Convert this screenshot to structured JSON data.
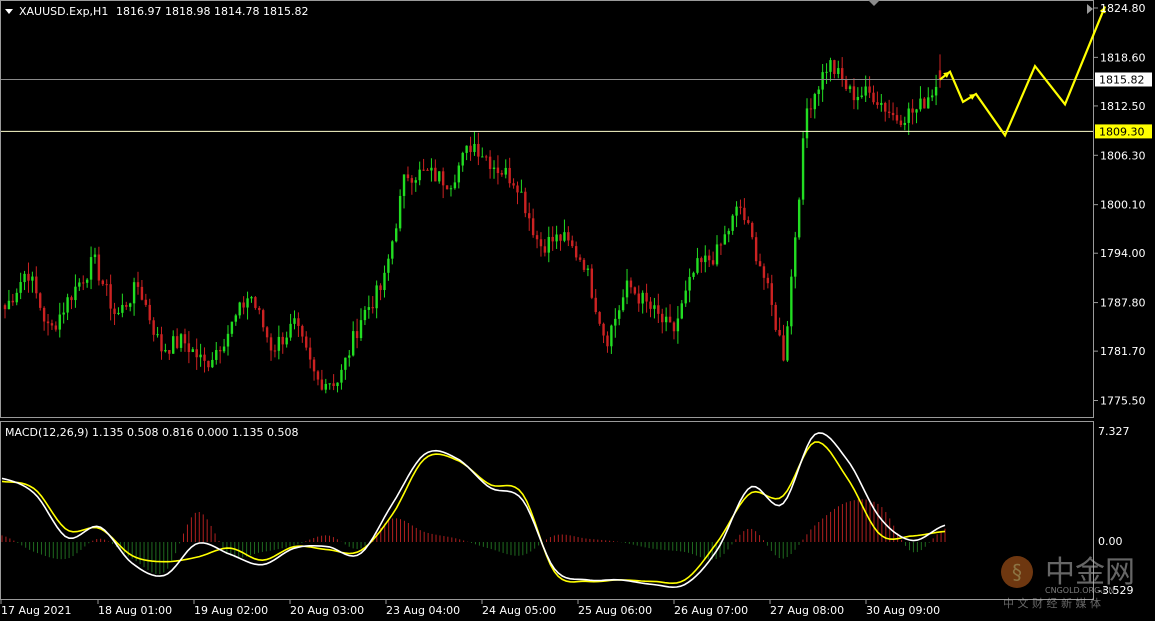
{
  "header": {
    "symbol_label": "XAUUSD.Exp,H1",
    "ohlc_text": "1816.97 1818.98 1814.78 1815.82"
  },
  "price_axis": {
    "ticks": [
      "1824.80",
      "1818.60",
      "1812.50",
      "1806.30",
      "1800.10",
      "1794.00",
      "1787.80",
      "1781.70",
      "1775.50"
    ],
    "current_price": "1815.82",
    "level_price": "1809.30"
  },
  "macd": {
    "label": "MACD(12,26,9) 1.135 0.508 0.816 0.000 1.135 0.508",
    "top_value": "7.327",
    "zero_value": "0.00",
    "bottom_value": "-3.529"
  },
  "time_axis": [
    "17 Aug 2021",
    "18 Aug 01:00",
    "19 Aug 02:00",
    "20 Aug 03:00",
    "23 Aug 04:00",
    "24 Aug 05:00",
    "25 Aug 06:00",
    "26 Aug 07:00",
    "27 Aug 08:00",
    "30 Aug 09:00"
  ],
  "watermark": {
    "cn": "中金网",
    "en": "CNGOLD.ORG.CN",
    "sub": "中 文 财 经 新 媒 体"
  },
  "colors": {
    "bull": "#22dd22",
    "bear": "#cc2222",
    "signal": "#ffff00",
    "macd_line": "#ffffff",
    "hist_pos": "#b02020",
    "hist_neg": "#1f6a1f",
    "level_line": "#ffffcc"
  },
  "chart_data": {
    "type": "candlestick",
    "symbol": "XAUUSD.Exp",
    "timeframe": "H1",
    "ohlc_last": {
      "open": 1816.97,
      "high": 1818.98,
      "low": 1814.78,
      "close": 1815.82
    },
    "y_range": [
      1772,
      1826
    ],
    "anchor_closes": [
      1787,
      1792,
      1784,
      1789,
      1793,
      1786,
      1790,
      1782,
      1783,
      1780,
      1784,
      1789,
      1782,
      1785,
      1778,
      1778,
      1786,
      1790,
      1804,
      1804,
      1803,
      1808,
      1805,
      1803,
      1795,
      1796,
      1793,
      1783,
      1790,
      1787,
      1784,
      1792,
      1794,
      1800,
      1792,
      1781,
      1812,
      1818,
      1814,
      1814,
      1811,
      1812,
      1815.82
    ],
    "projection_path": [
      1815.82,
      1816.8,
      1813,
      1814,
      1808.8,
      1817.5,
      1812.7,
      1825
    ],
    "horizontal_levels": [
      1815.82,
      1809.3
    ],
    "macd": {
      "params": "12,26,9",
      "range": [
        -3.529,
        7.327
      ],
      "main": [
        4.2,
        3.2,
        0.3,
        1.0,
        -1.4,
        -2.2,
        -0.1,
        -0.8,
        -1.5,
        -0.4,
        -0.3,
        -0.8,
        2.5,
        5.8,
        5.5,
        3.6,
        2.8,
        -1.8,
        -2.5,
        -2.5,
        -2.8,
        -2.8,
        -0.5,
        3.6,
        2.5,
        7.1,
        5.4,
        1.6,
        0.1,
        1.1
      ],
      "signal": [
        4.0,
        3.5,
        0.8,
        0.9,
        -0.9,
        -1.3,
        -1.0,
        -0.4,
        -1.2,
        -0.3,
        -0.5,
        -0.6,
        1.8,
        5.5,
        5.4,
        3.8,
        3.2,
        -2.0,
        -2.6,
        -2.5,
        -2.6,
        -2.5,
        0.0,
        3.2,
        3.0,
        6.6,
        4.2,
        0.5,
        0.4,
        0.7
      ]
    },
    "xlabel": "",
    "ylabel": "",
    "grid": false
  }
}
